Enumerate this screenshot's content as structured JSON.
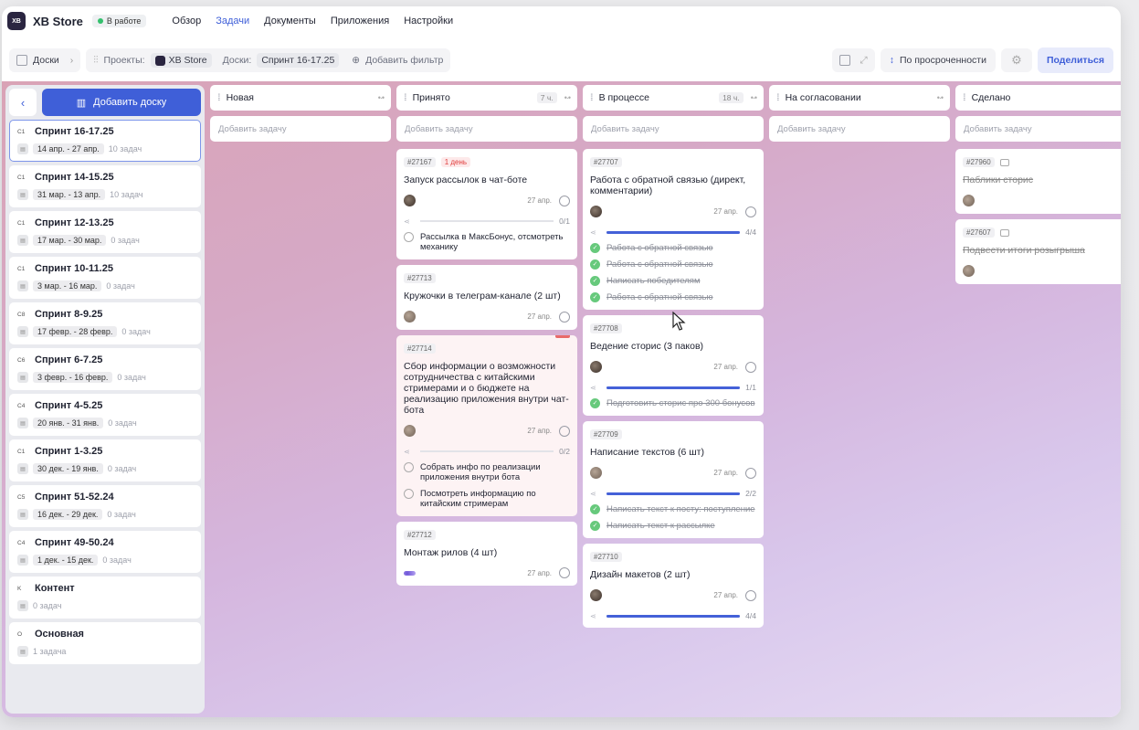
{
  "app": {
    "store_name": "XB Store",
    "logo_text": "XB",
    "status": "В работе",
    "nav": [
      "Обзор",
      "Задачи",
      "Документы",
      "Приложения",
      "Настройки"
    ],
    "active_nav": "Задачи"
  },
  "toolbar": {
    "boards_label": "Доски",
    "projects_label": "Проекты:",
    "project_name": "XB Store",
    "board_label": "Доски:",
    "board_value": "Спринт 16-17.25",
    "add_filter": "Добавить фильтр",
    "sort_label": "По просроченности",
    "share_label": "Поделиться"
  },
  "sidebar": {
    "add_board": "Добавить доску",
    "items": [
      {
        "code": "C1",
        "title": "Спринт 16-17.25",
        "date": "14 апр. - 27 апр.",
        "count": "10 задач",
        "selected": true
      },
      {
        "code": "C1",
        "title": "Спринт 14-15.25",
        "date": "31 мар. - 13 апр.",
        "count": "10 задач"
      },
      {
        "code": "C1",
        "title": "Спринт 12-13.25",
        "date": "17 мар. - 30 мар.",
        "count": "0 задач"
      },
      {
        "code": "C1",
        "title": "Спринт 10-11.25",
        "date": "3 мар. - 16 мар.",
        "count": "0 задач"
      },
      {
        "code": "C8",
        "title": "Спринт 8-9.25",
        "date": "17 февр. - 28 февр.",
        "count": "0 задач"
      },
      {
        "code": "C6",
        "title": "Спринт 6-7.25",
        "date": "3 февр. - 16 февр.",
        "count": "0 задач"
      },
      {
        "code": "C4",
        "title": "Спринт 4-5.25",
        "date": "20 янв. - 31 янв.",
        "count": "0 задач"
      },
      {
        "code": "C1",
        "title": "Спринт 1-3.25",
        "date": "30 дек. - 19 янв.",
        "count": "0 задач"
      },
      {
        "code": "C5",
        "title": "Спринт 51-52.24",
        "date": "16 дек. - 29 дек.",
        "count": "0 задач"
      },
      {
        "code": "C4",
        "title": "Спринт 49-50.24",
        "date": "1 дек. - 15 дек.",
        "count": "0 задач"
      },
      {
        "code": "K",
        "title": "Контент",
        "date": "",
        "count": "0 задач"
      },
      {
        "code": "O",
        "title": "Основная",
        "date": "",
        "count": "1 задача"
      }
    ]
  },
  "columns": {
    "add_task": "Добавить задачу",
    "new": {
      "title": "Новая",
      "count": ""
    },
    "accepted": {
      "title": "Принято",
      "count": "7 ч."
    },
    "in_progress": {
      "title": "В процессе",
      "count": "18 ч."
    },
    "review": {
      "title": "На согласовании",
      "count": ""
    },
    "done": {
      "title": "Сделано",
      "count": ""
    }
  },
  "cards": {
    "c27167": {
      "id": "#27167",
      "tag": "1 день",
      "title": "Запуск рассылок в чат-боте",
      "due": "27 апр.",
      "progress": "0/1",
      "sub1": "Рассылка в МаксБонус, отсмотреть механику"
    },
    "c27713": {
      "id": "#27713",
      "title": "Кружочки в телеграм-канале (2 шт)",
      "due": "27 апр."
    },
    "c27714": {
      "id": "#27714",
      "title": "Сбор информации о возможности сотрудничества с китайскими стримерами и о бюджете на реализацию приложения внутри чат-бота",
      "due": "27 апр.",
      "progress": "0/2",
      "sub1": "Собрать инфо по реализации приложения внутри бота",
      "sub2": "Посмотреть информацию по китайским стримерам"
    },
    "c27712": {
      "id": "#27712",
      "title": "Монтаж рилов (4 шт)",
      "due": "27 апр."
    },
    "c27707": {
      "id": "#27707",
      "title": "Работа с обратной связью (директ, комментарии)",
      "due": "27 апр.",
      "progress": "4/4",
      "sub1": "Работа с обратной связью",
      "sub2": "Работа с обратной связью",
      "sub3": "Написать победителям",
      "sub4": "Работа с обратной связью"
    },
    "c27708": {
      "id": "#27708",
      "title": "Ведение сторис (3 паков)",
      "due": "27 апр.",
      "progress": "1/1",
      "sub1": "Подготовить сторис про 300 бонусов"
    },
    "c27709": {
      "id": "#27709",
      "title": "Написание текстов (6 шт)",
      "due": "27 апр.",
      "progress": "2/2",
      "sub1": "Написать текст к посту: поступление",
      "sub2": "Написать текст к рассылке"
    },
    "c27710": {
      "id": "#27710",
      "title": "Дизайн макетов (2 шт)",
      "due": "27 апр.",
      "progress": "4/4"
    },
    "c27960": {
      "id": "#27960",
      "title": "Паблики сторис"
    },
    "c27607": {
      "id": "#27607",
      "title": "Подвести итоги розыгрыша"
    }
  },
  "colors": {
    "accent": "#3f5fd8",
    "status_green": "#34c06d",
    "tag_red": "#e03c3c"
  }
}
